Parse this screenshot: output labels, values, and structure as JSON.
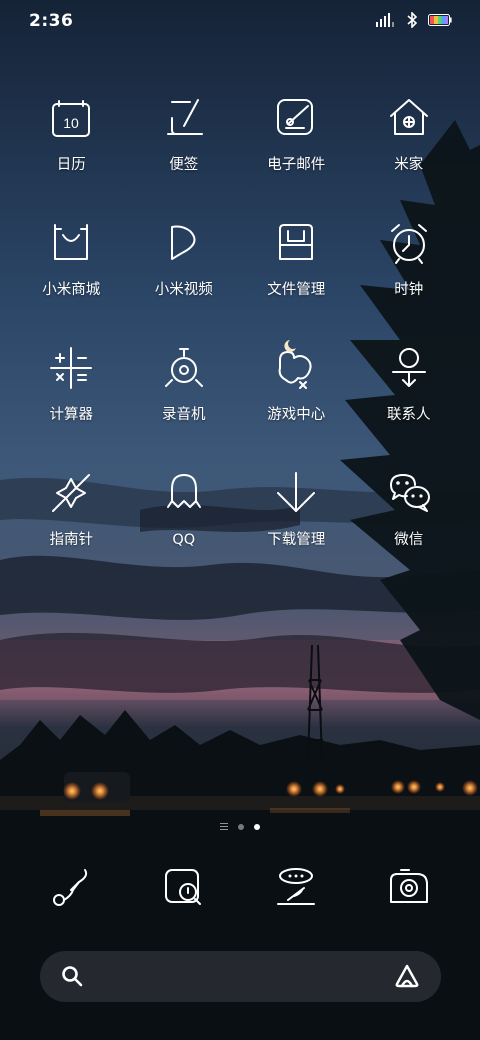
{
  "status_bar": {
    "time": "2:36",
    "icons": [
      "signal-icon",
      "bluetooth-icon",
      "battery-icon"
    ],
    "battery_colors": [
      "#e55",
      "#f0c040",
      "#5fd36b",
      "#4aa8ff",
      "#a87cff"
    ]
  },
  "apps": [
    {
      "label": "日历",
      "icon": "calendar-icon",
      "badge": "10"
    },
    {
      "label": "便签",
      "icon": "notes-icon"
    },
    {
      "label": "电子邮件",
      "icon": "email-icon"
    },
    {
      "label": "米家",
      "icon": "mijia-icon"
    },
    {
      "label": "小米商城",
      "icon": "mi-store-icon"
    },
    {
      "label": "小米视频",
      "icon": "mi-video-icon"
    },
    {
      "label": "文件管理",
      "icon": "file-manager-icon"
    },
    {
      "label": "时钟",
      "icon": "clock-icon"
    },
    {
      "label": "计算器",
      "icon": "calculator-icon"
    },
    {
      "label": "录音机",
      "icon": "recorder-icon"
    },
    {
      "label": "游戏中心",
      "icon": "game-center-icon"
    },
    {
      "label": "联系人",
      "icon": "contacts-icon"
    },
    {
      "label": "指南针",
      "icon": "compass-icon"
    },
    {
      "label": "QQ",
      "icon": "qq-icon"
    },
    {
      "label": "下载管理",
      "icon": "download-manager-icon"
    },
    {
      "label": "微信",
      "icon": "wechat-icon"
    }
  ],
  "page_indicator": {
    "pages": 2,
    "active_page": 2
  },
  "dock": [
    {
      "icon": "phone-icon"
    },
    {
      "icon": "messages-icon"
    },
    {
      "icon": "browser-icon"
    },
    {
      "icon": "camera-icon"
    }
  ],
  "search_bar": {
    "left_icon": "search-icon",
    "right_icon": "assistant-icon"
  }
}
